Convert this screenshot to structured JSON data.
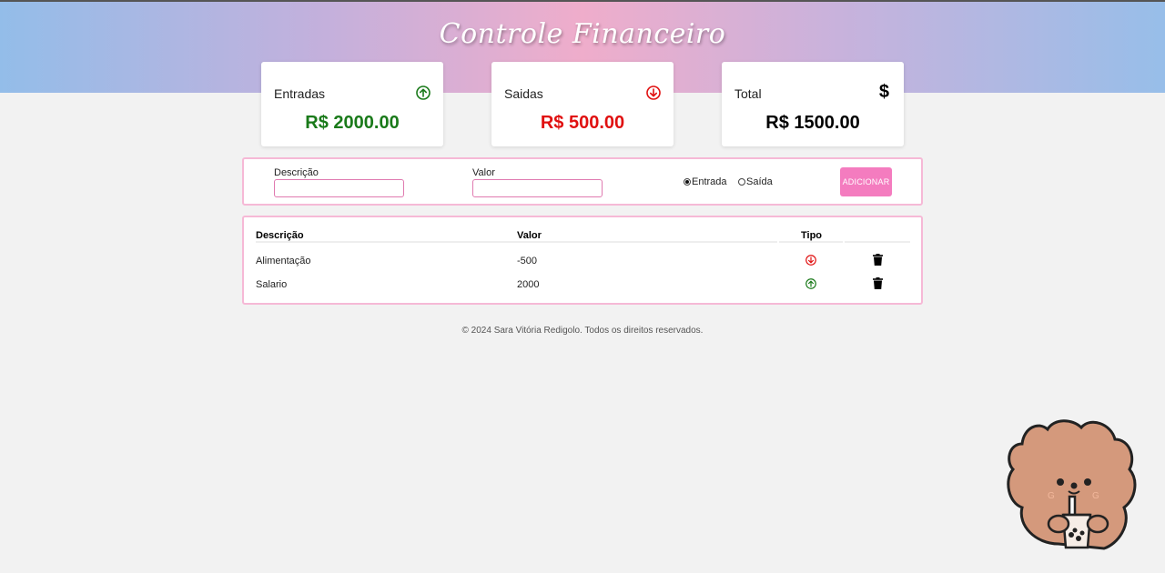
{
  "app": {
    "title": "Controle Financeiro"
  },
  "summary": {
    "entradas": {
      "label": "Entradas",
      "value": "R$ 2000.00",
      "icon": "arrow-up-circle-icon",
      "color": "#1a7a1a"
    },
    "saidas": {
      "label": "Saidas",
      "value": "R$ 500.00",
      "icon": "arrow-down-circle-icon",
      "color": "#e01010"
    },
    "total": {
      "label": "Total",
      "value": "R$ 1500.00",
      "icon": "$"
    }
  },
  "form": {
    "descricao_label": "Descrição",
    "descricao_value": "",
    "valor_label": "Valor",
    "valor_value": "",
    "radio_entrada": "Entrada",
    "radio_saida": "Saída",
    "selected_type": "Entrada",
    "add_button": "ADICIONAR"
  },
  "table": {
    "headers": [
      "Descrição",
      "Valor",
      "Tipo"
    ],
    "rows": [
      {
        "descricao": "Alimentação",
        "valor": "-500",
        "tipo": "saida"
      },
      {
        "descricao": "Salario",
        "valor": "2000",
        "tipo": "entrada"
      }
    ]
  },
  "footer": {
    "text": "© 2024 Sara Vitória Redigolo. Todos os direitos reservados."
  },
  "colors": {
    "accent": "#f47cbf",
    "border": "#f6b9d6",
    "income": "#1a7a1a",
    "expense": "#e01010"
  }
}
